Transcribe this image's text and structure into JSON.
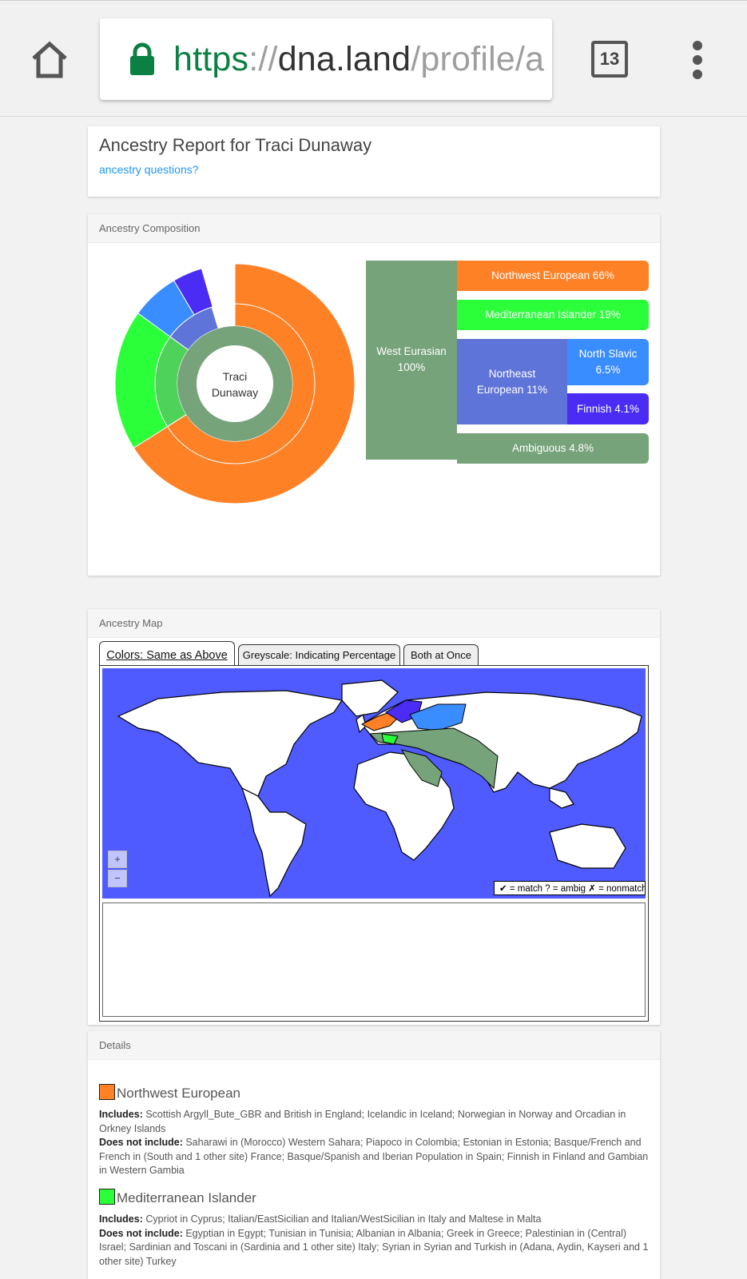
{
  "browser": {
    "url_scheme": "https",
    "url_sep": "://",
    "url_host": "dna.land",
    "url_path": "/profile/a",
    "tab_count": "13",
    "colors": {
      "secure_green": "#0b8043"
    }
  },
  "report": {
    "title": "Ancestry Report for Traci Dunaway",
    "questions_link": "ancestry questions?"
  },
  "composition": {
    "header": "Ancestry Composition",
    "center_label_line1": "Traci",
    "center_label_line2": "Dunaway",
    "segments": [
      {
        "name": "West Eurasian",
        "percent": 100,
        "label_line1": "West Eurasian",
        "label_line2": "100%",
        "color": "#76a37a"
      },
      {
        "name": "Northwest European",
        "percent": 66,
        "label": "Northwest European 66%",
        "color": "#fe8126"
      },
      {
        "name": "Mediterranean Islander",
        "percent": 19,
        "label": "Mediterranean Islander 19%",
        "color": "#2bff3a"
      },
      {
        "name": "Northeast European",
        "percent": 11,
        "label_line1": "Northeast",
        "label_line2": "European 11%",
        "color": "#5e74d8"
      },
      {
        "name": "North Slavic",
        "percent": 6.5,
        "label_line1": "North Slavic",
        "label_line2": "6.5%",
        "color": "#3a8dff"
      },
      {
        "name": "Finnish",
        "percent": 4.1,
        "label": "Finnish 4.1%",
        "color": "#4a2cf5"
      },
      {
        "name": "Ambiguous",
        "percent": 4.8,
        "label": "Ambiguous 4.8%",
        "color": "#76a37a"
      }
    ]
  },
  "map": {
    "header": "Ancestry Map",
    "tabs": [
      "Colors: Same as Above",
      "Greyscale: Indicating Percentage",
      "Both at Once"
    ],
    "zoom_in": "+",
    "zoom_out": "−",
    "legend": "✔ = match  ? = ambig  ✗ = nonmatch",
    "colors": {
      "ocean": "#4f5bff",
      "land": "#ffffff"
    }
  },
  "details": {
    "header": "Details",
    "items": [
      {
        "name": "Northwest European",
        "color": "#fe8126",
        "includes_label": "Includes:",
        "includes": " Scottish Argyll_Bute_GBR and British in England; Icelandic in Iceland; Norwegian in Norway and Orcadian in Orkney Islands",
        "excludes_label": "Does not include:",
        "excludes": " Saharawi in (Morocco) Western Sahara; Piapoco in Colombia; Estonian in Estonia; Basque/French and French in (South and 1 other site) France; Basque/Spanish and Iberian Population in Spain; Finnish in Finland and Gambian in Western Gambia"
      },
      {
        "name": "Mediterranean Islander",
        "color": "#2bff3a",
        "includes_label": "Includes:",
        "includes": " Cypriot in Cyprus; Italian/EastSicilian and Italian/WestSicilian in Italy and Maltese in Malta",
        "excludes_label": "Does not include:",
        "excludes": " Egyptian in Egypt; Tunisian in Tunisia; Albanian in Albania; Greek in Greece; Palestinian in (Central) Israel; Sardinian and Toscani in (Sardinia and 1 other site) Italy; Syrian in Syrian and Turkish in (Adana, Aydin, Kayseri and 1 other site) Turkey"
      }
    ]
  }
}
